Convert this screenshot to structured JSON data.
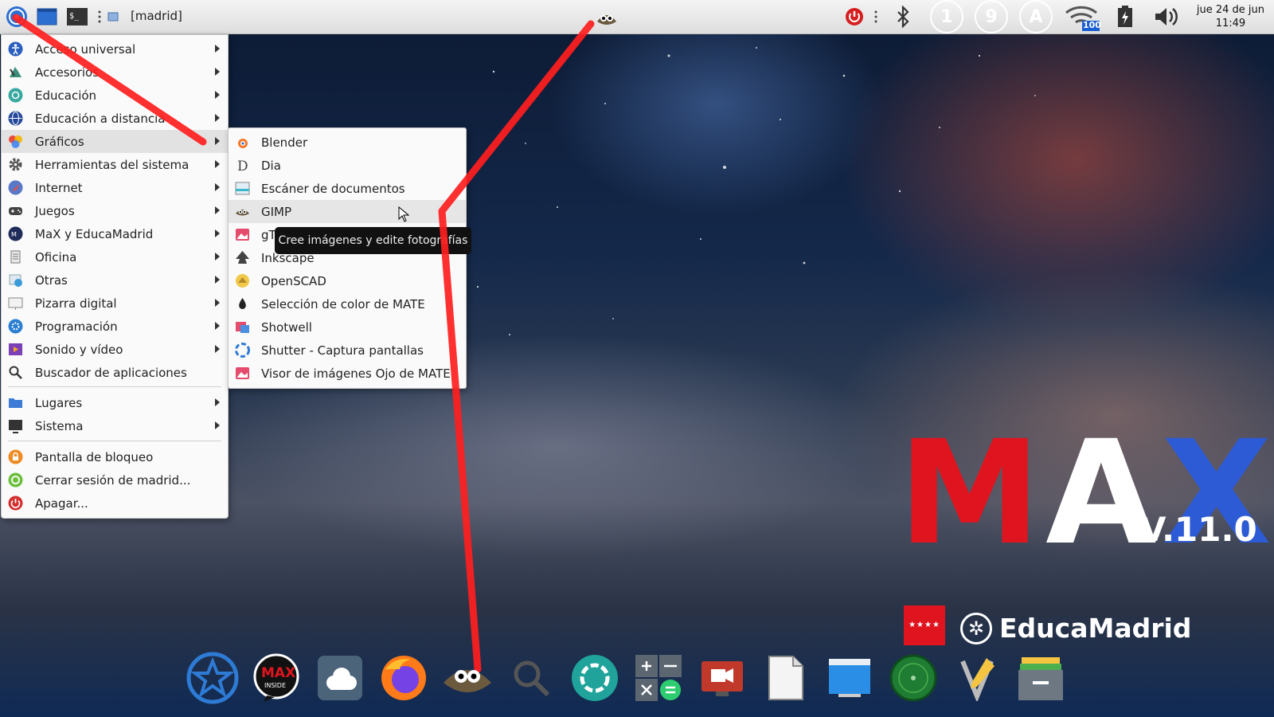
{
  "top_panel": {
    "workspace_label": "[madrid]",
    "clock_date": "jue 24 de jun",
    "clock_time": "11:49",
    "wifi_level": "100",
    "indicators": [
      "1",
      "9",
      "A"
    ]
  },
  "main_menu": {
    "items": [
      {
        "label": "Acceso universal",
        "icon": "accessibility-icon",
        "submenu": true
      },
      {
        "label": "Accesorios",
        "icon": "accessories-icon",
        "submenu": true
      },
      {
        "label": "Educación",
        "icon": "education-icon",
        "submenu": true
      },
      {
        "label": "Educación a distancia",
        "icon": "globe-icon",
        "submenu": true
      },
      {
        "label": "Gráficos",
        "icon": "graphics-icon",
        "submenu": true,
        "active": true
      },
      {
        "label": "Herramientas del sistema",
        "icon": "gear-icon",
        "submenu": true
      },
      {
        "label": "Internet",
        "icon": "internet-icon",
        "submenu": true
      },
      {
        "label": "Juegos",
        "icon": "gamepad-icon",
        "submenu": true
      },
      {
        "label": "MaX y EducaMadrid",
        "icon": "max-icon",
        "submenu": true
      },
      {
        "label": "Oficina",
        "icon": "office-icon",
        "submenu": true
      },
      {
        "label": "Otras",
        "icon": "other-icon",
        "submenu": true
      },
      {
        "label": "Pizarra digital",
        "icon": "whiteboard-icon",
        "submenu": true
      },
      {
        "label": "Programación",
        "icon": "programming-icon",
        "submenu": true
      },
      {
        "label": "Sonido y vídeo",
        "icon": "multimedia-icon",
        "submenu": true
      },
      {
        "label": "Buscador de aplicaciones",
        "icon": "search-icon",
        "submenu": false
      }
    ],
    "places": [
      {
        "label": "Lugares",
        "icon": "folder-icon",
        "submenu": true
      },
      {
        "label": "Sistema",
        "icon": "monitor-icon",
        "submenu": true
      }
    ],
    "session": [
      {
        "label": "Pantalla de bloqueo",
        "icon": "lock-icon"
      },
      {
        "label": "Cerrar sesión de madrid...",
        "icon": "logout-icon"
      },
      {
        "label": "Apagar...",
        "icon": "power-icon"
      }
    ]
  },
  "graphics_submenu": {
    "items": [
      {
        "label": "Blender",
        "icon": "blender-icon"
      },
      {
        "label": "Dia",
        "icon": "dia-icon"
      },
      {
        "label": "Escáner de documentos",
        "icon": "scanner-icon"
      },
      {
        "label": "GIMP",
        "icon": "gimp-icon",
        "active": true
      },
      {
        "label": "gThumb",
        "icon": "gthumb-icon"
      },
      {
        "label": "Inkscape",
        "icon": "inkscape-icon"
      },
      {
        "label": "OpenSCAD",
        "icon": "openscad-icon"
      },
      {
        "label": "Selección de color de MATE",
        "icon": "color-picker-icon"
      },
      {
        "label": "Shotwell",
        "icon": "shotwell-icon"
      },
      {
        "label": "Shutter - Captura pantallas",
        "icon": "shutter-icon"
      },
      {
        "label": "Visor de imágenes Ojo de MATE",
        "icon": "image-viewer-icon"
      }
    ],
    "tooltip": "Cree imágenes y edite fotografías"
  },
  "branding": {
    "max_m": "M",
    "max_a": "A",
    "max_x": "X",
    "version": "V.11.0",
    "educamadrid": "EducaMadrid",
    "flag_stars": "★★★★"
  },
  "dock": {
    "items": [
      "star-app-icon",
      "max-inside-icon",
      "cloud-icon",
      "firefox-icon",
      "gimp-icon",
      "search-icon",
      "shutter-icon",
      "calculator-icon",
      "video-call-icon",
      "document-icon",
      "window-icon",
      "radar-icon",
      "text-editor-icon",
      "archive-icon"
    ],
    "max_inside_text": "MAX",
    "max_inside_sub": "INSIDE"
  },
  "colors": {
    "max_red": "#e0141f",
    "max_blue": "#2d5bd6",
    "annotation_red": "#ff1e1e"
  }
}
